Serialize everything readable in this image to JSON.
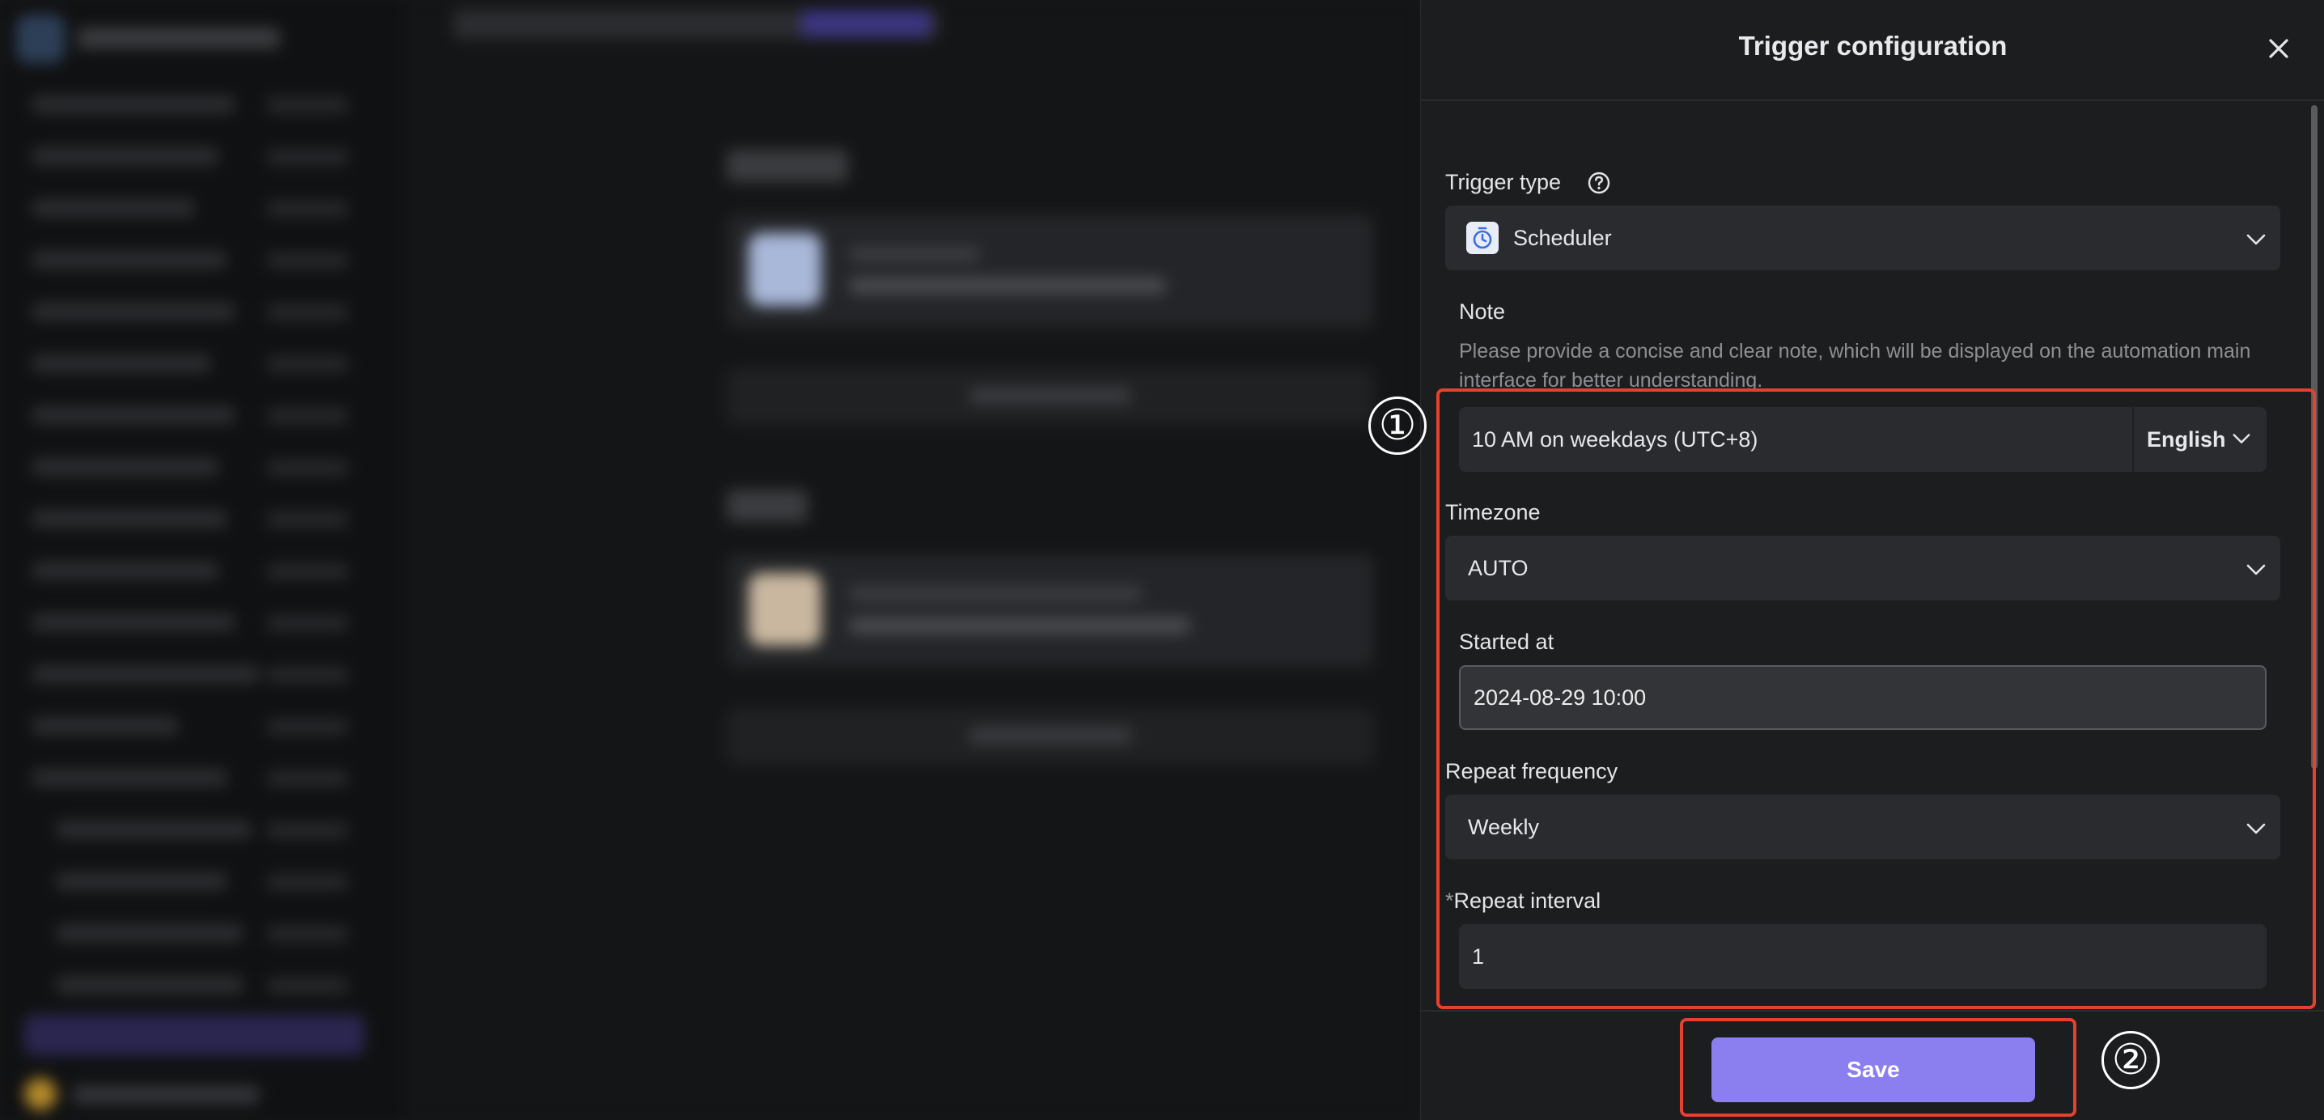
{
  "drawer": {
    "title": "Trigger configuration",
    "trigger_type": {
      "label": "Trigger type",
      "value": "Scheduler"
    },
    "note": {
      "label": "Note",
      "description_line1": "Please provide a concise and clear note, which will be displayed on the automation main",
      "description_line2": "interface for better understanding.",
      "value": "10 AM on weekdays (UTC+8)",
      "language": "English"
    },
    "timezone": {
      "label": "Timezone",
      "value": "AUTO"
    },
    "started_at": {
      "label": "Started at",
      "value": "2024-08-29 10:00"
    },
    "repeat_frequency": {
      "label": "Repeat frequency",
      "value": "Weekly"
    },
    "repeat_interval": {
      "required_mark": "*",
      "label": "Repeat interval",
      "value": "1"
    },
    "save_label": "Save"
  },
  "annotations": {
    "step1": "①",
    "step2": "②"
  },
  "colors": {
    "accent": "#8b7ff0",
    "annotation": "#e5412f"
  }
}
